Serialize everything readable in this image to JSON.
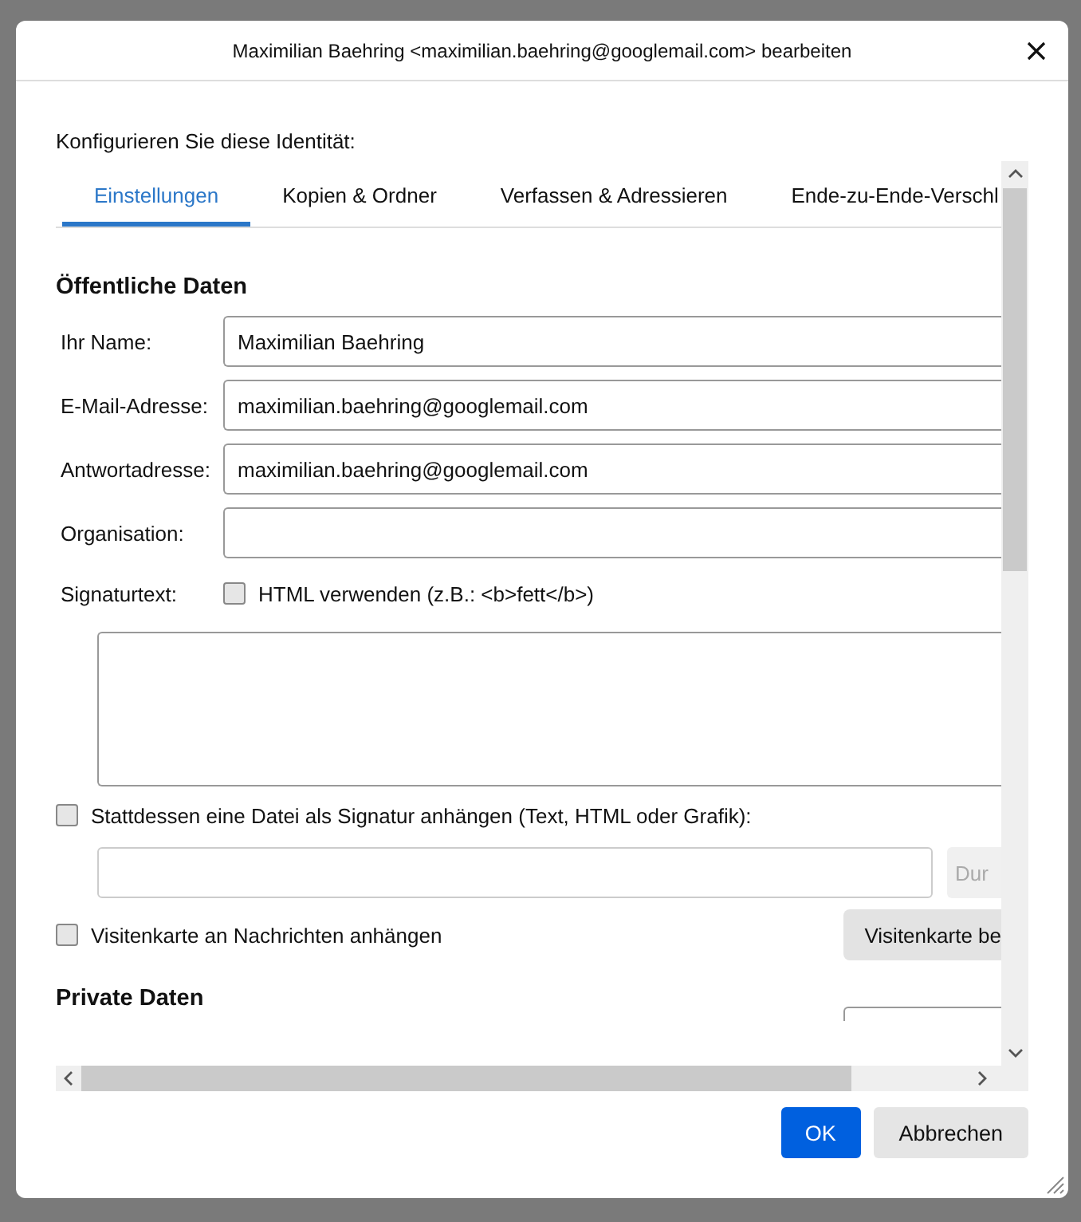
{
  "dialog": {
    "title": "Maximilian Baehring <maximilian.baehring@googlemail.com> bearbeiten",
    "intro": "Konfigurieren Sie diese Identität:"
  },
  "tabs": [
    {
      "label": "Einstellungen",
      "selected": true
    },
    {
      "label": "Kopien & Ordner",
      "selected": false
    },
    {
      "label": "Verfassen & Adressieren",
      "selected": false
    },
    {
      "label": "Ende-zu-Ende-Verschl",
      "selected": false
    }
  ],
  "public_data": {
    "heading": "Öffentliche Daten",
    "fields": [
      {
        "label": "Ihr Name:",
        "value": "Maximilian Baehring"
      },
      {
        "label": "E-Mail-Adresse:",
        "value": "maximilian.baehring@googlemail.com"
      },
      {
        "label": "Antwortadresse:",
        "value": "maximilian.baehring@googlemail.com"
      },
      {
        "label": "Organisation:"
      }
    ],
    "signature": {
      "label": "Signaturtext:",
      "html_option": {
        "label": "HTML verwenden (z.B.: <b>fett</b>)",
        "checked": false
      }
    },
    "attach_file": {
      "label": "Stattdessen eine Datei als Signatur anhängen (Text, HTML oder Grafik):",
      "checked": false
    },
    "browse_button": {
      "label": "Dur",
      "disabled": true
    },
    "vcard": {
      "label": "Visitenkarte an Nachrichten anhängen",
      "checked": false
    },
    "vcard_button": {
      "label": "Visitenkarte be",
      "disabled": false
    }
  },
  "private_data": {
    "heading": "Private Daten"
  },
  "buttons": [
    {
      "label": "OK",
      "kind": "primary"
    },
    {
      "label": "Abbrechen",
      "kind": "secondary"
    }
  ]
}
